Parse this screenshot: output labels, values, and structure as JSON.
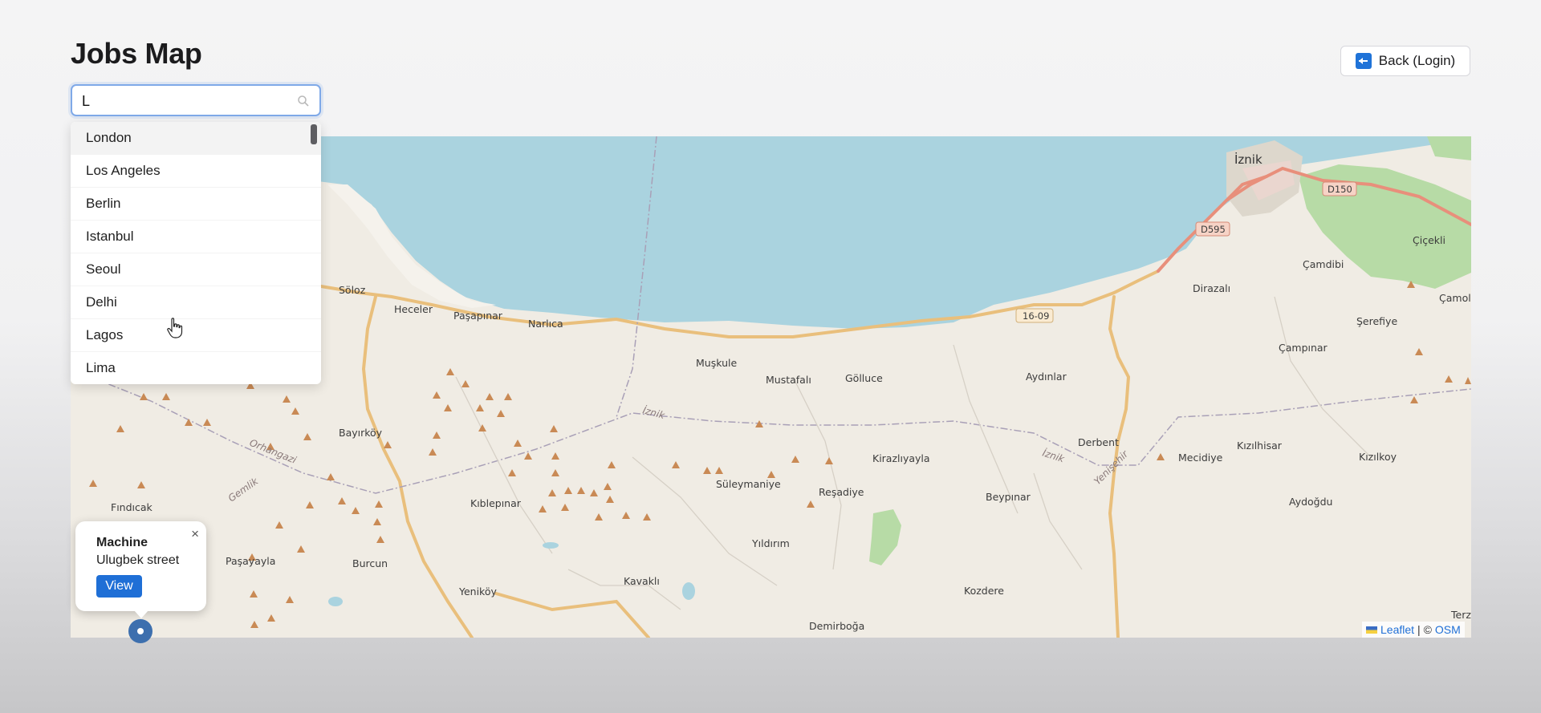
{
  "header": {
    "title": "Jobs Map",
    "back_label": "Back (Login)"
  },
  "search": {
    "value": "L",
    "placeholder": ""
  },
  "dropdown": {
    "items": [
      "London",
      "Los Angeles",
      "Berlin",
      "Istanbul",
      "Seoul",
      "Delhi",
      "Lagos",
      "Lima"
    ],
    "highlighted": "London"
  },
  "map": {
    "places": [
      "İznik",
      "Çiçekli",
      "Çamdibi",
      "Dirazalı",
      "Şerefiye",
      "Çampınar",
      "Çamolu",
      "Söloz",
      "Heceler",
      "Paşapınar",
      "Narlıca",
      "Muşkule",
      "Mustafalı",
      "Gölluce",
      "Aydınlar",
      "Derbent",
      "Bayırköy",
      "Kirazlıyayla",
      "Mecidiye",
      "Kızılhisar",
      "Kızılkoy",
      "Fındıcak",
      "Kıblepınar",
      "Süleymaniye",
      "Reşadiye",
      "Beypınar",
      "Aydoğdu",
      "Yıldırım",
      "Paşayayla",
      "Burcun",
      "Yeniköy",
      "Kavaklı",
      "Kozdere",
      "Demirboğa",
      "Terz"
    ],
    "road_labels": [
      "D150",
      "D595",
      "16-09"
    ],
    "water_labels": [
      "İznik",
      "İznik",
      "Orhangazi",
      "Gemlik",
      "Yenişehir"
    ],
    "attribution": {
      "leaflet": "Leaflet",
      "separator": "| ©",
      "osm": "OSM"
    }
  },
  "popup": {
    "title": "Machine",
    "address": "Ulugbek street",
    "view_label": "View",
    "close_label": "×"
  },
  "colors": {
    "accent": "#1f6fd6",
    "water": "#aad3df",
    "land": "#f0ece4",
    "road_major": "#e9bf7c",
    "road_primary": "#e88f7b",
    "forest": "#b7dba6"
  }
}
